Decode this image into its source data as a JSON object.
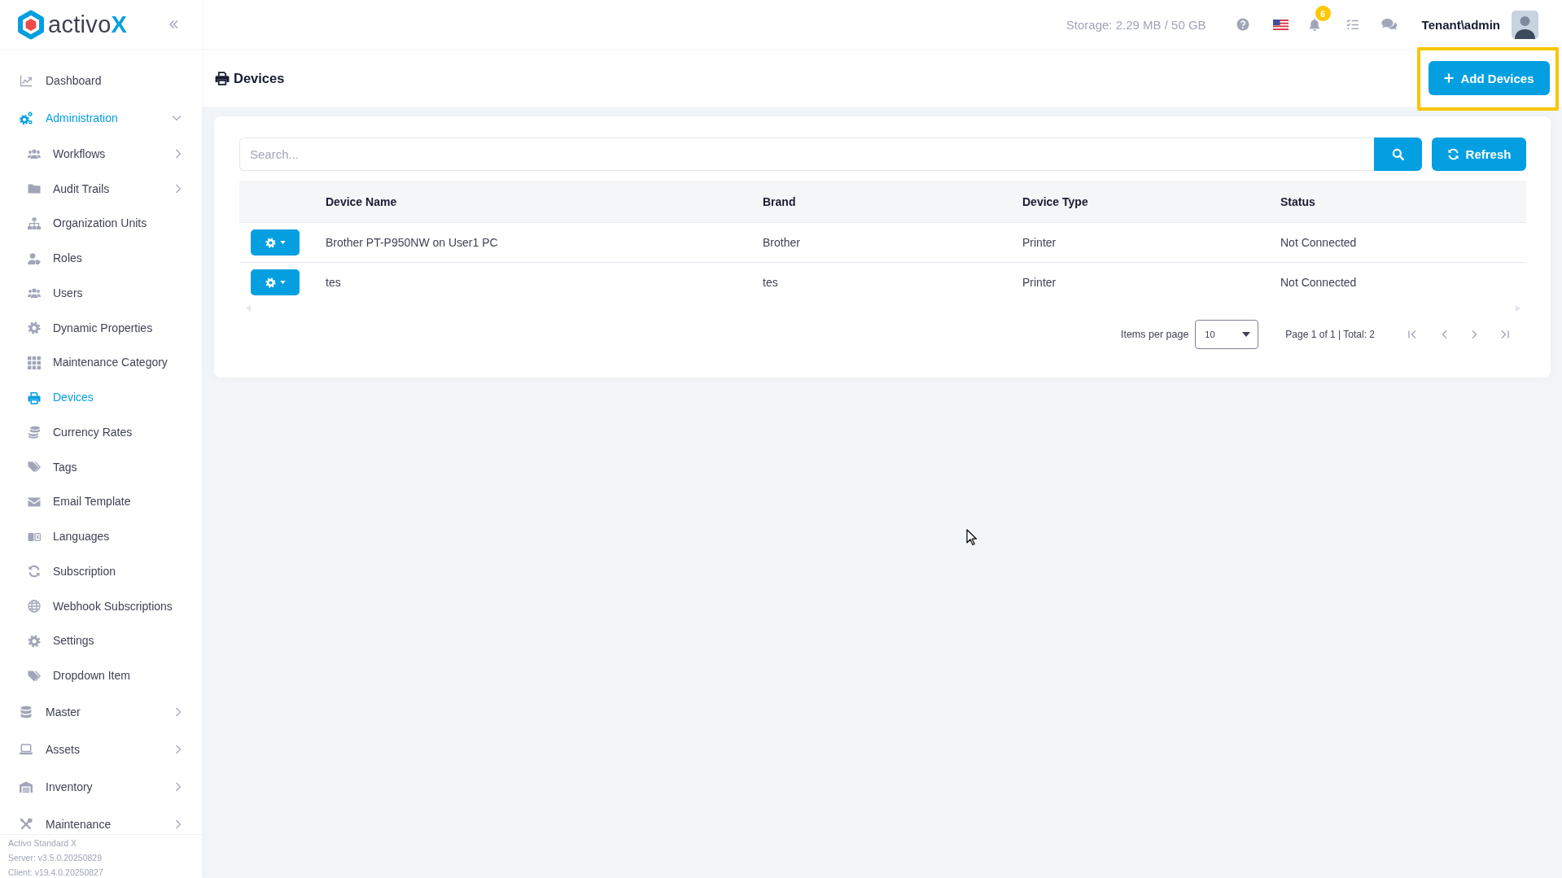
{
  "sidebar": {
    "logo": {
      "text": "activo",
      "accent": "X"
    },
    "items": [
      {
        "kind": "link",
        "label": "Dashboard",
        "selected": false
      },
      {
        "kind": "group",
        "label": "Administration",
        "selected": true,
        "expanded": true,
        "children": [
          {
            "kind": "group",
            "label": "Workflows",
            "selected": false,
            "expanded": false
          },
          {
            "kind": "group",
            "label": "Audit Trails",
            "selected": false,
            "expanded": false
          },
          {
            "kind": "link",
            "label": "Organization Units",
            "selected": false
          },
          {
            "kind": "link",
            "label": "Roles",
            "selected": false
          },
          {
            "kind": "link",
            "label": "Users",
            "selected": false
          },
          {
            "kind": "link",
            "label": "Dynamic Properties",
            "selected": false
          },
          {
            "kind": "link",
            "label": "Maintenance Category",
            "selected": false
          },
          {
            "kind": "link",
            "label": "Devices",
            "selected": true
          },
          {
            "kind": "link",
            "label": "Currency Rates",
            "selected": false
          },
          {
            "kind": "link",
            "label": "Tags",
            "selected": false
          },
          {
            "kind": "link",
            "label": "Email Template",
            "selected": false
          },
          {
            "kind": "link",
            "label": "Languages",
            "selected": false
          },
          {
            "kind": "link",
            "label": "Subscription",
            "selected": false
          },
          {
            "kind": "link",
            "label": "Webhook Subscriptions",
            "selected": false
          },
          {
            "kind": "link",
            "label": "Settings",
            "selected": false
          },
          {
            "kind": "link",
            "label": "Dropdown Item",
            "selected": false
          }
        ]
      },
      {
        "kind": "group",
        "label": "Master",
        "selected": false,
        "expanded": false
      },
      {
        "kind": "group",
        "label": "Assets",
        "selected": false,
        "expanded": false
      },
      {
        "kind": "group",
        "label": "Inventory",
        "selected": false,
        "expanded": false
      },
      {
        "kind": "group",
        "label": "Maintenance",
        "selected": false,
        "expanded": false
      }
    ],
    "footer": [
      "Activo Standard X",
      "Server: v3.5.0.20250829",
      "Client: v19.4.0.20250827"
    ]
  },
  "topbar": {
    "storage": "Storage: 2.29 MB / 50 GB",
    "notifications": "6",
    "user": "Tenant\\admin"
  },
  "page": {
    "title": "Devices",
    "add_button": {
      "label": "Add Devices",
      "highlighted": true
    }
  },
  "toolbar": {
    "search": {
      "placeholder": "Search..."
    },
    "refresh": "Refresh"
  },
  "table": {
    "columns": [
      "Device Name",
      "Brand",
      "Device Type",
      "Status"
    ],
    "rows": [
      [
        "Brother PT-P950NW on User1 PC",
        "Brother",
        "Printer",
        "Not Connected"
      ],
      [
        "tes",
        "tes",
        "Printer",
        "Not Connected"
      ]
    ]
  },
  "pagination": {
    "items_per_page_label": "Items per page",
    "page_size": "10",
    "summary": "Page 1 of 1 | Total: 2"
  }
}
